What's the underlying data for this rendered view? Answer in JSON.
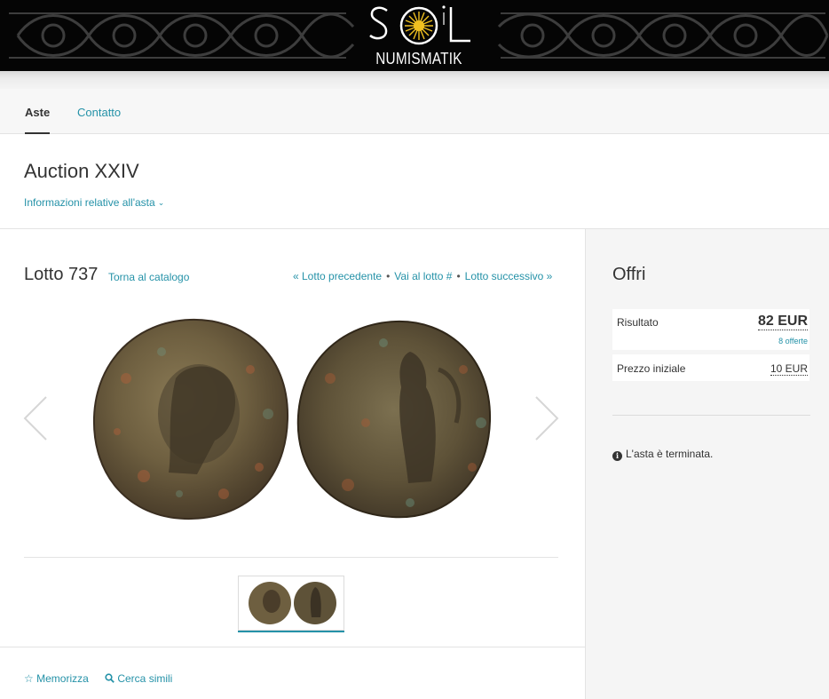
{
  "brand": {
    "logo_name": "NUMISMATIK"
  },
  "nav": {
    "tabs": [
      {
        "label": "Aste",
        "active": true
      },
      {
        "label": "Contatto",
        "active": false
      }
    ]
  },
  "auction": {
    "title": "Auction XXIV",
    "info_link": "Informazioni relative all'asta"
  },
  "lot": {
    "title": "Lotto 737",
    "back_link": "Torna al catalogo",
    "prev": "« Lotto precedente",
    "goto": "Vai al lotto #",
    "next": "Lotto successivo »",
    "separator": "•"
  },
  "actions": {
    "memorize": "Memorizza",
    "search_similar": "Cerca simili"
  },
  "offers": {
    "title": "Offri",
    "result_label": "Risultato",
    "result_value": "82 EUR",
    "bids": "8 offerte",
    "start_label": "Prezzo iniziale",
    "start_value": "10 EUR",
    "ended": "L'asta è terminata."
  },
  "colors": {
    "accent": "#2592a8",
    "text": "#333333",
    "banner": "#050505"
  },
  "icons": [
    "chevron-down-icon",
    "chevron-left-icon",
    "chevron-right-icon",
    "star-icon",
    "magnifier-icon",
    "info-icon"
  ]
}
